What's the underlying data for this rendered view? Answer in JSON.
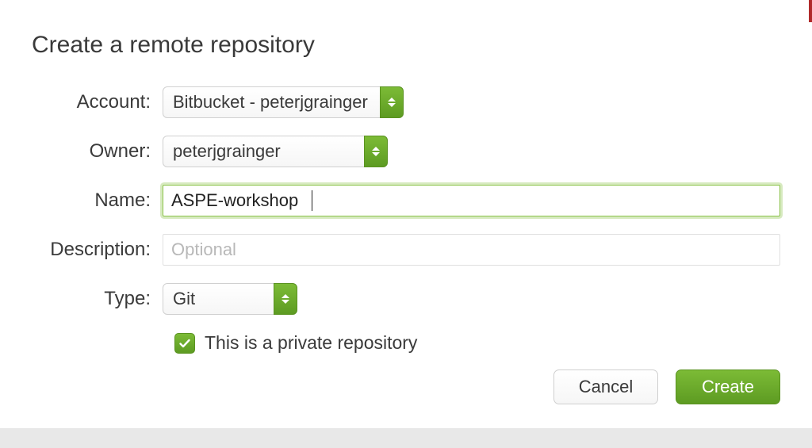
{
  "dialog": {
    "title": "Create a remote repository",
    "labels": {
      "account": "Account:",
      "owner": "Owner:",
      "name": "Name:",
      "description": "Description:",
      "type": "Type:"
    },
    "fields": {
      "account_value": "Bitbucket - peterjgrainger",
      "owner_value": "peterjgrainger",
      "name_value": "ASPE-workshop",
      "description_value": "",
      "description_placeholder": "Optional",
      "type_value": "Git",
      "private_checked": true,
      "private_label": "This is a private repository"
    },
    "buttons": {
      "cancel": "Cancel",
      "create": "Create"
    }
  }
}
